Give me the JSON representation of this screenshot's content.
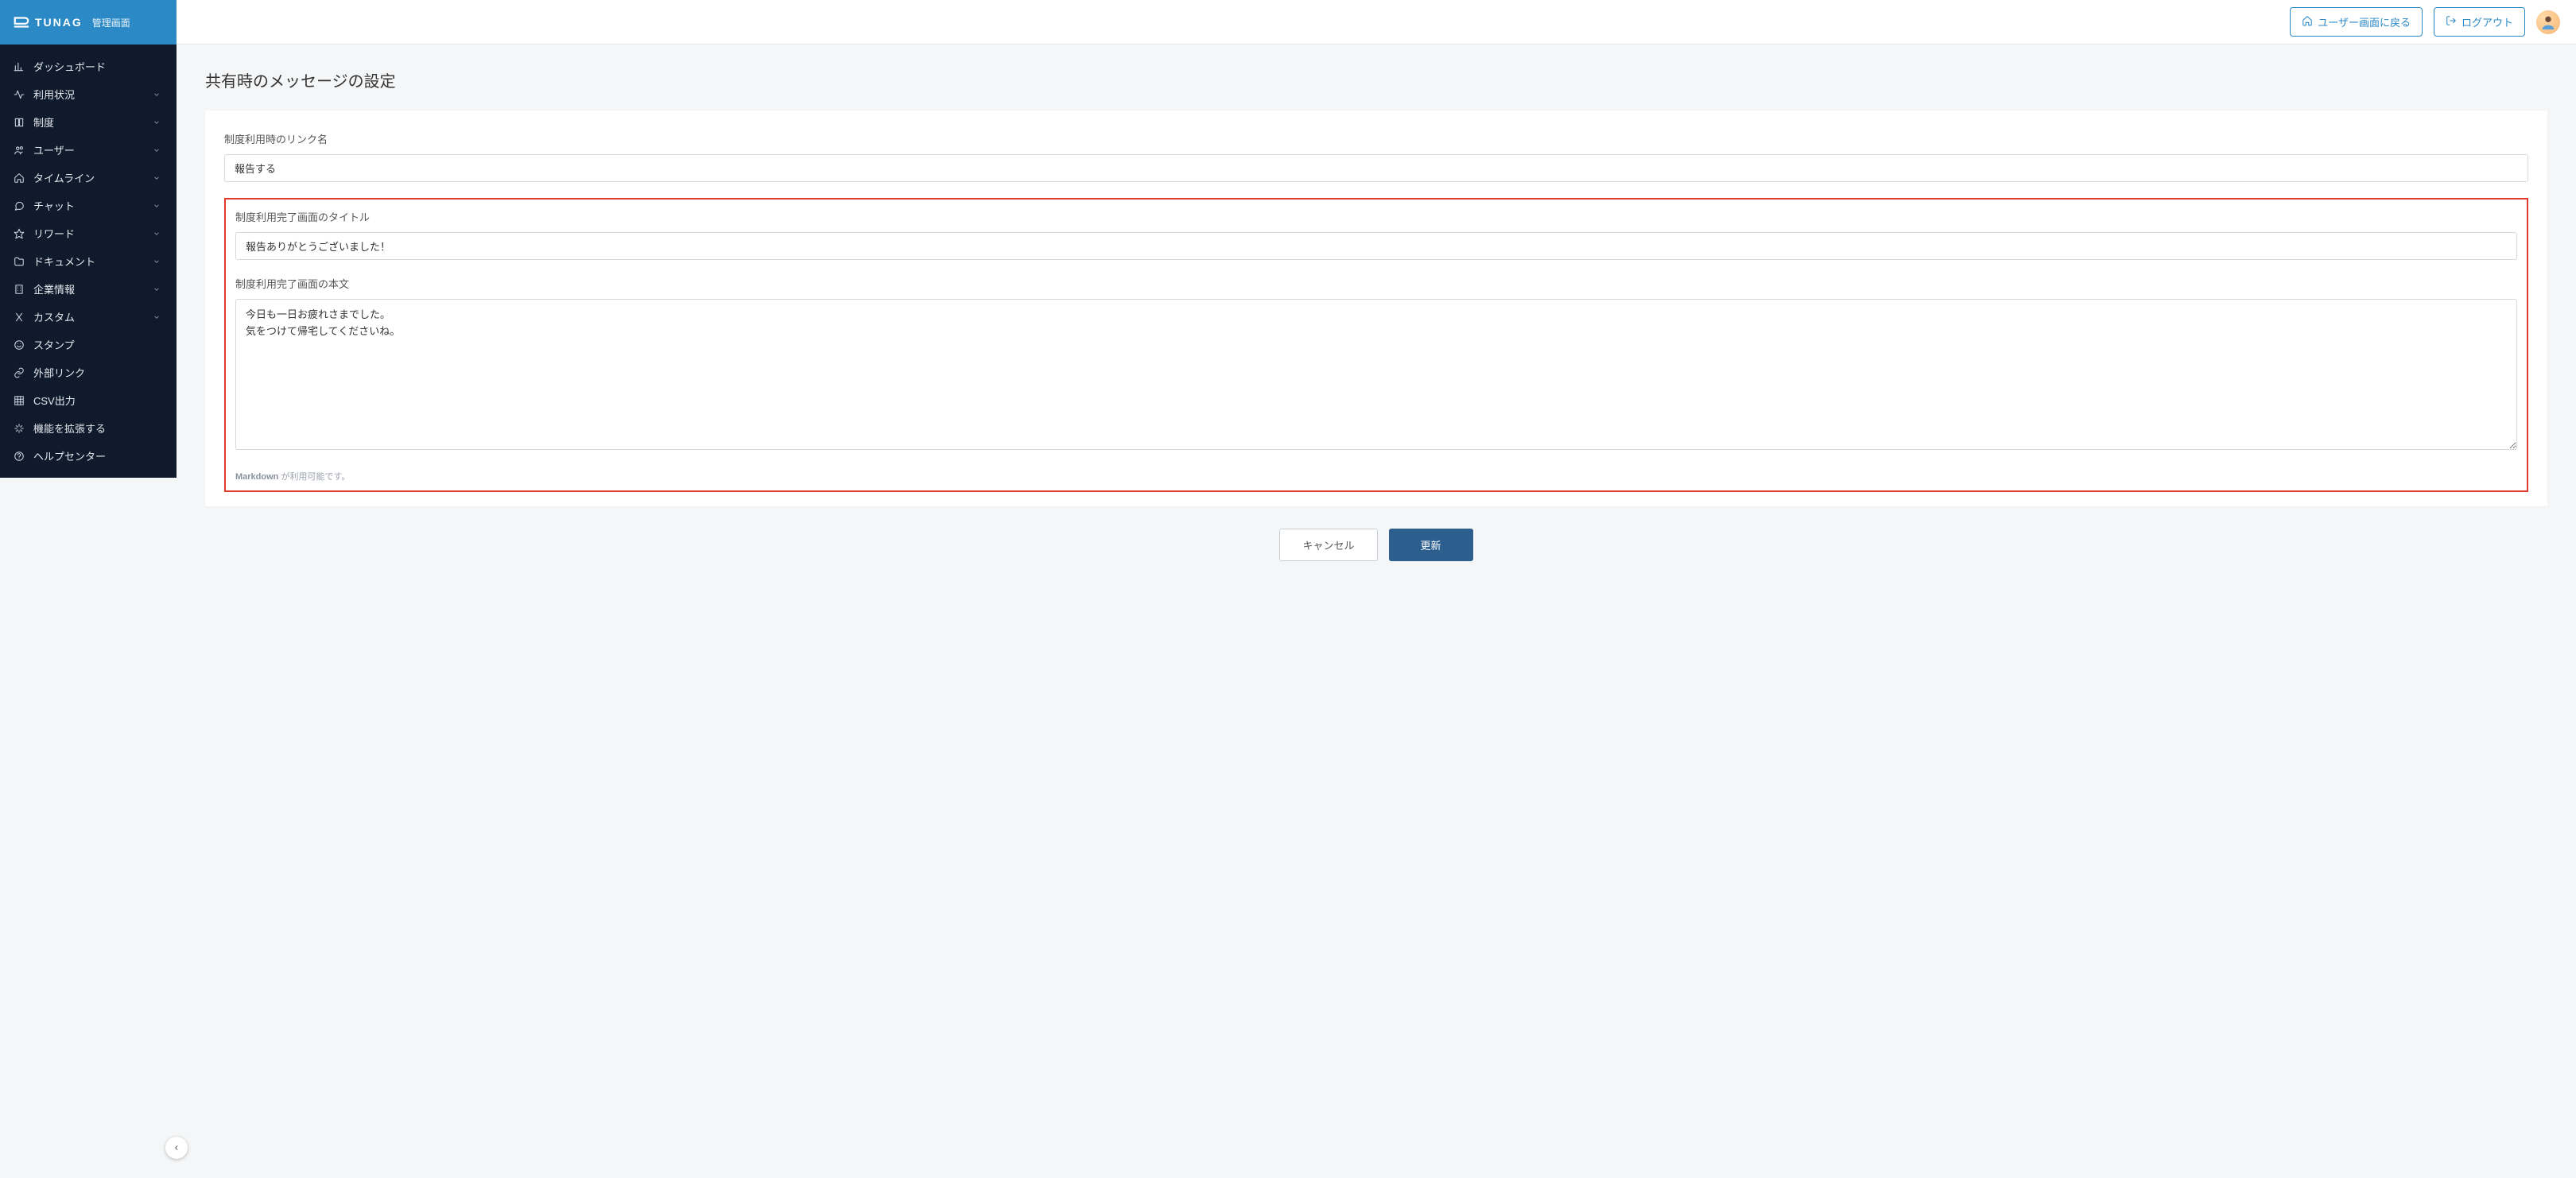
{
  "brand": {
    "name": "TUNAG",
    "subtitle": "管理画面"
  },
  "topbar": {
    "back_label": "ユーザー画面に戻る",
    "logout_label": "ログアウト"
  },
  "sidebar": {
    "items": [
      {
        "icon": "chart-icon",
        "label": "ダッシュボード",
        "expandable": false
      },
      {
        "icon": "activity-icon",
        "label": "利用状況",
        "expandable": true
      },
      {
        "icon": "book-icon",
        "label": "制度",
        "expandable": true
      },
      {
        "icon": "users-icon",
        "label": "ユーザー",
        "expandable": true
      },
      {
        "icon": "home-icon",
        "label": "タイムライン",
        "expandable": true
      },
      {
        "icon": "chat-icon",
        "label": "チャット",
        "expandable": true
      },
      {
        "icon": "star-icon",
        "label": "リワード",
        "expandable": true
      },
      {
        "icon": "folder-icon",
        "label": "ドキュメント",
        "expandable": true
      },
      {
        "icon": "building-icon",
        "label": "企業情報",
        "expandable": true
      },
      {
        "icon": "custom-icon",
        "label": "カスタム",
        "expandable": true
      },
      {
        "icon": "smile-icon",
        "label": "スタンプ",
        "expandable": false
      },
      {
        "icon": "link-icon",
        "label": "外部リンク",
        "expandable": false
      },
      {
        "icon": "grid-icon",
        "label": "CSV出力",
        "expandable": false
      },
      {
        "icon": "sparkle-icon",
        "label": "機能を拡張する",
        "expandable": false
      },
      {
        "icon": "help-icon",
        "label": "ヘルプセンター",
        "expandable": false
      }
    ]
  },
  "page": {
    "title": "共有時のメッセージの設定"
  },
  "form": {
    "link_name_label": "制度利用時のリンク名",
    "link_name_value": "報告する",
    "completion_title_label": "制度利用完了画面のタイトル",
    "completion_title_value": "報告ありがとうございました！",
    "completion_body_label": "制度利用完了画面の本文",
    "completion_body_value": "今日も一日お疲れさまでした。\n気をつけて帰宅してくださいね。",
    "helper_bold": "Markdown",
    "helper_rest": " が利用可能です。"
  },
  "actions": {
    "cancel": "キャンセル",
    "submit": "更新"
  }
}
